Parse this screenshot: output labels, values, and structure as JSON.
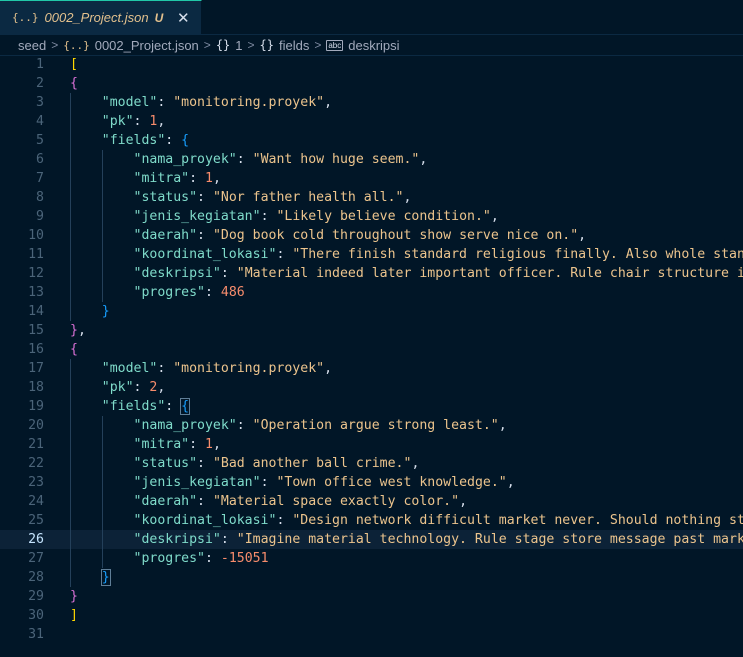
{
  "tab": {
    "icon": "{..}",
    "filename": "0002_Project.json",
    "status": "U",
    "close": "✕"
  },
  "breadcrumb": [
    "seed",
    "0002_Project.json",
    "1",
    "fields",
    "deskripsi"
  ],
  "editor": {
    "active_line": 26,
    "records": [
      {
        "model": "monitoring.proyek",
        "pk": 1,
        "fields": {
          "nama_proyek": "Want how huge seem.",
          "mitra": 1,
          "status": "Nor father health all.",
          "jenis_kegiatan": "Likely believe condition.",
          "daerah": "Dog book cold throughout show serve nice on.",
          "koordinat_lokasi": "There finish standard religious finally. Also whole standar",
          "deskripsi": "Material indeed later important officer. Rule chair structure if h",
          "progres": 486
        }
      },
      {
        "model": "monitoring.proyek",
        "pk": 2,
        "fields": {
          "nama_proyek": "Operation argue strong least.",
          "mitra": 1,
          "status": "Bad another ball crime.",
          "jenis_kegiatan": "Town office west knowledge.",
          "daerah": "Material space exactly color.",
          "koordinat_lokasi": "Design network difficult market never. Should nothing stop",
          "deskripsi": "Imagine material technology. Rule stage store message past market.",
          "progres": -15051
        }
      }
    ]
  }
}
